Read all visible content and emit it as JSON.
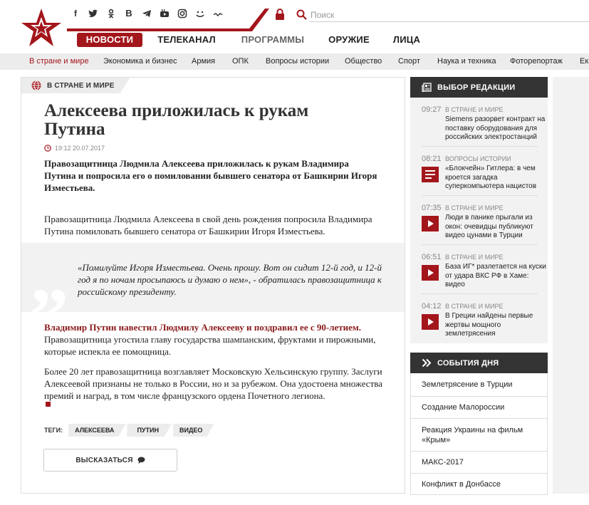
{
  "header": {
    "search_placeholder": "Поиск",
    "nav": [
      {
        "label": "НОВОСТИ"
      },
      {
        "label": "ТЕЛЕКАНАЛ"
      },
      {
        "label": "ПРОГРАММЫ"
      },
      {
        "label": "ОРУЖИЕ"
      },
      {
        "label": "ЛИЦА"
      }
    ],
    "social": [
      "facebook-icon",
      "twitter-icon",
      "odnoklassniki-icon",
      "vkontakte-icon",
      "telegram-icon",
      "youtube-icon",
      "instagram-icon",
      "yandex-zen-icon",
      "email-icon"
    ]
  },
  "subnav": [
    {
      "label": "В стране и мире"
    },
    {
      "label": "Экономика и бизнес"
    },
    {
      "label": "Армия"
    },
    {
      "label": "ОПК"
    },
    {
      "label": "Вопросы истории"
    },
    {
      "label": "Общество"
    },
    {
      "label": "Спорт"
    },
    {
      "label": "Наука и техника"
    },
    {
      "label": "Фоторепортаж"
    },
    {
      "label": "Ек"
    }
  ],
  "article": {
    "rubric": "В СТРАНЕ И МИРЕ",
    "title": "Алексеева приложилась к рукам Путина",
    "date": "19:12 20.07.2017",
    "lead": "Правозащитница Людмила Алексеева приложилась к рукам Владимира Путина и попросила его о помиловании бывшего сенатора от Башкирии Игоря Изместьева.",
    "para1": "Правозащитница Людмила Алексеева в свой день рождения попросила Владимира Путина помиловать бывшего сенатора от Башкирии Игоря Изместьева.",
    "quote": "«Помилуйте Игоря Изместьева. Очень прошу. Вот он сидит 12-й год, и 12-й год я по ночам просыпаюсь и думаю о нем», - обратилась правозащитница к российскому президенту.",
    "para2_link": "Владимир Путин навестил Людмилу Алексееву и поздравил ее с 90-летием.",
    "para2_rest": " Правозащитница угостила главу государства шампанским, фруктами и пирожными, которые испекла ее помощница.",
    "para3": "Более 20 лет правозащитница возглавляет Московскую Хельсинскую группу. Заслуги Алексеевой признаны не только в России, но и за рубежом. Она удостоена множества премий и наград, в том числе французского ордена Почетного легиона.",
    "tags_label": "ТЕГИ:",
    "tags": [
      "АЛЕКСЕЕВА",
      "ПУТИН",
      "ВИДЕО"
    ],
    "comment_label": "ВЫСКАЗАТЬСЯ"
  },
  "sidebar": {
    "editors_title": "ВЫБОР РЕДАКЦИИ",
    "feed": [
      {
        "time": "09:27",
        "cat": "В СТРАНЕ И МИРЕ",
        "text": "Siemens разорвет контракт на поставку оборудования для российских электростанций",
        "type": "none"
      },
      {
        "time": "08:21",
        "cat": "ВОПРОСЫ ИСТОРИИ",
        "text": "«Блокчейн» Гитлера: в чем кроется загадка суперкомпьютера нацистов",
        "type": "article"
      },
      {
        "time": "07:35",
        "cat": "В СТРАНЕ И МИРЕ",
        "text": "Люди в панике прыгали из окон: очевидцы публикуют видео цунами в Турции",
        "type": "video"
      },
      {
        "time": "06:51",
        "cat": "В СТРАНЕ И МИРЕ",
        "text": "База ИГ* разлетается на куски от удара ВКС РФ в Хаме: видео",
        "type": "video"
      },
      {
        "time": "04:12",
        "cat": "В СТРАНЕ И МИРЕ",
        "text": "В Греции найдены первые жертвы мощного землетрясения",
        "type": "video"
      }
    ],
    "topics_title": "СОБЫТИЯ ДНЯ",
    "topics": [
      "Землетрясение в Турции",
      "Создание Малороссии",
      "Реакция Украины на фильм «Крым»",
      "МАКС-2017",
      "Конфликт в Донбассе"
    ]
  },
  "colors": {
    "accent": "#a3161c",
    "dark": "#333333",
    "gray": "#ececec"
  }
}
